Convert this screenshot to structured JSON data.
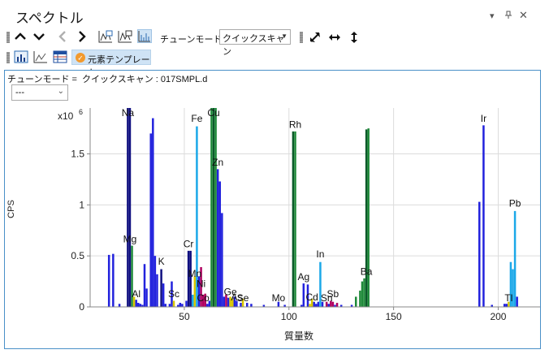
{
  "window": {
    "title": "スペクトル",
    "pin_icon": "▾",
    "close_icon": "✕"
  },
  "toolbar": {
    "tune_mode_label": "チューンモード:",
    "tune_mode_value": "クイックスキャン",
    "template_label": "元素テンプレート"
  },
  "panel": {
    "header_text": "チューンモード =  クイックスキャン : 017SMPL.d",
    "dropdown_value": "---"
  },
  "chart_data": {
    "type": "bar",
    "xlabel": "質量数",
    "ylabel": "CPS",
    "multiplier": "x10",
    "multiplier_exp": "6",
    "xlim": [
      5,
      220
    ],
    "ylim": [
      0,
      1.95
    ],
    "xticks": [
      50,
      100,
      150,
      200
    ],
    "yticks": [
      0,
      0.5,
      1,
      1.5
    ],
    "ytick_labels": [
      "0",
      "0.5",
      "1",
      "1.5"
    ],
    "grid": true,
    "colors": {
      "dark_blue": "#1414c8",
      "blue": "#2222dd",
      "cyan": "#1ba8e8",
      "green": "#1f8a3a",
      "dark_green": "#0b5a2a",
      "magenta": "#b00060",
      "yellow": "#d8c600",
      "navy": "#101080"
    },
    "peaks": [
      {
        "x": 14,
        "y": 0.51,
        "c": "blue"
      },
      {
        "x": 16,
        "y": 0.52,
        "c": "blue"
      },
      {
        "x": 19,
        "y": 0.03,
        "c": "blue"
      },
      {
        "x": 23,
        "y": 1.95,
        "c": "navy"
      },
      {
        "x": 24,
        "y": 1.95,
        "c": "navy"
      },
      {
        "x": 25,
        "y": 0.6,
        "c": "green"
      },
      {
        "x": 26,
        "y": 0.1,
        "c": "yellow"
      },
      {
        "x": 27,
        "y": 0.07,
        "c": "blue"
      },
      {
        "x": 28,
        "y": 0.04,
        "c": "blue"
      },
      {
        "x": 29,
        "y": 0.03,
        "c": "blue"
      },
      {
        "x": 30,
        "y": 0.02,
        "c": "blue"
      },
      {
        "x": 31,
        "y": 0.42,
        "c": "blue"
      },
      {
        "x": 32,
        "y": 0.18,
        "c": "blue"
      },
      {
        "x": 34,
        "y": 1.7,
        "c": "blue"
      },
      {
        "x": 35,
        "y": 1.85,
        "c": "blue"
      },
      {
        "x": 36,
        "y": 0.5,
        "c": "blue"
      },
      {
        "x": 37,
        "y": 0.32,
        "c": "blue"
      },
      {
        "x": 39,
        "y": 0.37,
        "c": "navy"
      },
      {
        "x": 40,
        "y": 0.23,
        "c": "blue"
      },
      {
        "x": 41,
        "y": 0.03,
        "c": "blue"
      },
      {
        "x": 43,
        "y": 0.03,
        "c": "blue"
      },
      {
        "x": 44,
        "y": 0.25,
        "c": "blue"
      },
      {
        "x": 45,
        "y": 0.06,
        "c": "yellow"
      },
      {
        "x": 47,
        "y": 0.02,
        "c": "blue"
      },
      {
        "x": 48,
        "y": 0.04,
        "c": "blue"
      },
      {
        "x": 49,
        "y": 0.03,
        "c": "blue"
      },
      {
        "x": 51,
        "y": 0.06,
        "c": "blue"
      },
      {
        "x": 52,
        "y": 0.55,
        "c": "navy"
      },
      {
        "x": 53,
        "y": 0.55,
        "c": "navy"
      },
      {
        "x": 54,
        "y": 0.12,
        "c": "cyan"
      },
      {
        "x": 55,
        "y": 0.3,
        "c": "yellow"
      },
      {
        "x": 56,
        "y": 1.77,
        "c": "cyan"
      },
      {
        "x": 57,
        "y": 0.3,
        "c": "blue"
      },
      {
        "x": 58,
        "y": 0.39,
        "c": "magenta"
      },
      {
        "x": 59,
        "y": 0.12,
        "c": "magenta"
      },
      {
        "x": 60,
        "y": 0.13,
        "c": "magenta"
      },
      {
        "x": 61,
        "y": 0.03,
        "c": "blue"
      },
      {
        "x": 62,
        "y": 0.06,
        "c": "blue"
      },
      {
        "x": 63,
        "y": 1.95,
        "c": "green"
      },
      {
        "x": 64,
        "y": 1.95,
        "c": "dark_green"
      },
      {
        "x": 65,
        "y": 1.95,
        "c": "green"
      },
      {
        "x": 66,
        "y": 1.35,
        "c": "blue"
      },
      {
        "x": 67,
        "y": 1.23,
        "c": "blue"
      },
      {
        "x": 68,
        "y": 0.92,
        "c": "blue"
      },
      {
        "x": 69,
        "y": 0.1,
        "c": "blue"
      },
      {
        "x": 70,
        "y": 0.12,
        "c": "magenta"
      },
      {
        "x": 71,
        "y": 0.09,
        "c": "blue"
      },
      {
        "x": 72,
        "y": 0.1,
        "c": "yellow"
      },
      {
        "x": 73,
        "y": 0.08,
        "c": "yellow"
      },
      {
        "x": 74,
        "y": 0.1,
        "c": "blue"
      },
      {
        "x": 75,
        "y": 0.06,
        "c": "blue"
      },
      {
        "x": 77,
        "y": 0.04,
        "c": "blue"
      },
      {
        "x": 78,
        "y": 0.08,
        "c": "yellow"
      },
      {
        "x": 80,
        "y": 0.04,
        "c": "blue"
      },
      {
        "x": 82,
        "y": 0.03,
        "c": "blue"
      },
      {
        "x": 88,
        "y": 0.02,
        "c": "blue"
      },
      {
        "x": 95,
        "y": 0.05,
        "c": "blue"
      },
      {
        "x": 98,
        "y": 0.02,
        "c": "blue"
      },
      {
        "x": 102,
        "y": 1.72,
        "c": "dark_green"
      },
      {
        "x": 103,
        "y": 1.72,
        "c": "green"
      },
      {
        "x": 106,
        "y": 0.02,
        "c": "blue"
      },
      {
        "x": 107,
        "y": 0.23,
        "c": "blue"
      },
      {
        "x": 109,
        "y": 0.22,
        "c": "blue"
      },
      {
        "x": 110,
        "y": 0.03,
        "c": "yellow"
      },
      {
        "x": 111,
        "y": 0.08,
        "c": "yellow"
      },
      {
        "x": 112,
        "y": 0.05,
        "c": "blue"
      },
      {
        "x": 113,
        "y": 0.03,
        "c": "blue"
      },
      {
        "x": 114,
        "y": 0.05,
        "c": "blue"
      },
      {
        "x": 115,
        "y": 0.44,
        "c": "cyan"
      },
      {
        "x": 116,
        "y": 0.05,
        "c": "blue"
      },
      {
        "x": 118,
        "y": 0.05,
        "c": "magenta"
      },
      {
        "x": 119,
        "y": 0.03,
        "c": "blue"
      },
      {
        "x": 120,
        "y": 0.06,
        "c": "magenta"
      },
      {
        "x": 121,
        "y": 0.05,
        "c": "magenta"
      },
      {
        "x": 122,
        "y": 0.02,
        "c": "blue"
      },
      {
        "x": 123,
        "y": 0.04,
        "c": "magenta"
      },
      {
        "x": 125,
        "y": 0.02,
        "c": "blue"
      },
      {
        "x": 130,
        "y": 0.02,
        "c": "blue"
      },
      {
        "x": 132,
        "y": 0.1,
        "c": "green"
      },
      {
        "x": 134,
        "y": 0.16,
        "c": "green"
      },
      {
        "x": 135,
        "y": 0.25,
        "c": "green"
      },
      {
        "x": 136,
        "y": 0.28,
        "c": "green"
      },
      {
        "x": 137,
        "y": 1.74,
        "c": "dark_green"
      },
      {
        "x": 138,
        "y": 1.75,
        "c": "green"
      },
      {
        "x": 191,
        "y": 1.03,
        "c": "blue"
      },
      {
        "x": 193,
        "y": 1.78,
        "c": "blue"
      },
      {
        "x": 197,
        "y": 0.02,
        "c": "blue"
      },
      {
        "x": 203,
        "y": 0.03,
        "c": "blue"
      },
      {
        "x": 204,
        "y": 0.03,
        "c": "blue"
      },
      {
        "x": 205,
        "y": 0.05,
        "c": "yellow"
      },
      {
        "x": 206,
        "y": 0.44,
        "c": "cyan"
      },
      {
        "x": 207,
        "y": 0.37,
        "c": "cyan"
      },
      {
        "x": 208,
        "y": 0.94,
        "c": "cyan"
      },
      {
        "x": 209,
        "y": 0.1,
        "c": "blue"
      }
    ],
    "labels": [
      {
        "text": "Na",
        "x": 23,
        "y": 1.96
      },
      {
        "text": "Mg",
        "x": 24,
        "y": 0.61
      },
      {
        "text": "Al",
        "x": 27,
        "y": 0.07
      },
      {
        "text": "K",
        "x": 39,
        "y": 0.39
      },
      {
        "text": "Sc",
        "x": 45,
        "y": 0.07
      },
      {
        "text": "Cr",
        "x": 52,
        "y": 0.56
      },
      {
        "text": "Mn",
        "x": 55,
        "y": 0.27
      },
      {
        "text": "Fe",
        "x": 56,
        "y": 1.79
      },
      {
        "text": "Ni",
        "x": 58,
        "y": 0.17
      },
      {
        "text": "Co",
        "x": 59,
        "y": 0.03
      },
      {
        "text": "Cu",
        "x": 64,
        "y": 1.86
      },
      {
        "text": "Zn",
        "x": 66,
        "y": 1.36
      },
      {
        "text": "Ge",
        "x": 72,
        "y": 0.09
      },
      {
        "text": "As",
        "x": 75,
        "y": 0.04
      },
      {
        "text": "Se",
        "x": 78,
        "y": 0.03
      },
      {
        "text": "Mo",
        "x": 95,
        "y": 0.03
      },
      {
        "text": "Rh",
        "x": 103,
        "y": 1.73
      },
      {
        "text": "Ag",
        "x": 107,
        "y": 0.24
      },
      {
        "text": "Cd",
        "x": 111,
        "y": 0.04
      },
      {
        "text": "In",
        "x": 115,
        "y": 0.46
      },
      {
        "text": "Sn",
        "x": 118,
        "y": 0.03
      },
      {
        "text": "Sb",
        "x": 121,
        "y": 0.07
      },
      {
        "text": "Ba",
        "x": 137,
        "y": 0.29
      },
      {
        "text": "Ir",
        "x": 193,
        "y": 1.79
      },
      {
        "text": "Tl",
        "x": 205,
        "y": 0.03
      },
      {
        "text": "Pb",
        "x": 208,
        "y": 0.96
      }
    ]
  }
}
